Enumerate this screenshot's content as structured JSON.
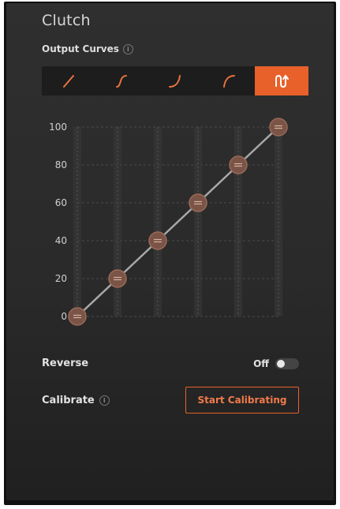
{
  "panel": {
    "title": "Clutch",
    "output_curves_label": "Output Curves",
    "info_glyph": "i"
  },
  "curves": [
    {
      "name": "linear",
      "icon": "linear-curve-icon",
      "active": false
    },
    {
      "name": "s-curve",
      "icon": "s-curve-icon",
      "active": false
    },
    {
      "name": "exponential",
      "icon": "exponential-curve-icon",
      "active": false
    },
    {
      "name": "logarithmic",
      "icon": "logarithmic-curve-icon",
      "active": false
    },
    {
      "name": "custom",
      "icon": "custom-curve-icon",
      "active": true
    }
  ],
  "chart_data": {
    "type": "line",
    "x": [
      0,
      20,
      40,
      60,
      80,
      100
    ],
    "y": [
      0,
      20,
      40,
      60,
      80,
      100
    ],
    "yticks": [
      "100",
      "80",
      "60",
      "40",
      "20",
      "0"
    ],
    "ylim": [
      0,
      100
    ],
    "xlim": [
      0,
      100
    ],
    "grid": true,
    "colors": {
      "line": "#a8a8a8",
      "point": "#7a5446",
      "grid": "#4a4a4a"
    }
  },
  "reverse": {
    "label": "Reverse",
    "state_text": "Off",
    "on": false
  },
  "calibrate": {
    "label": "Calibrate",
    "button_label": "Start Calibrating"
  },
  "colors": {
    "accent": "#e8612b",
    "background": "#2d2d2d"
  }
}
